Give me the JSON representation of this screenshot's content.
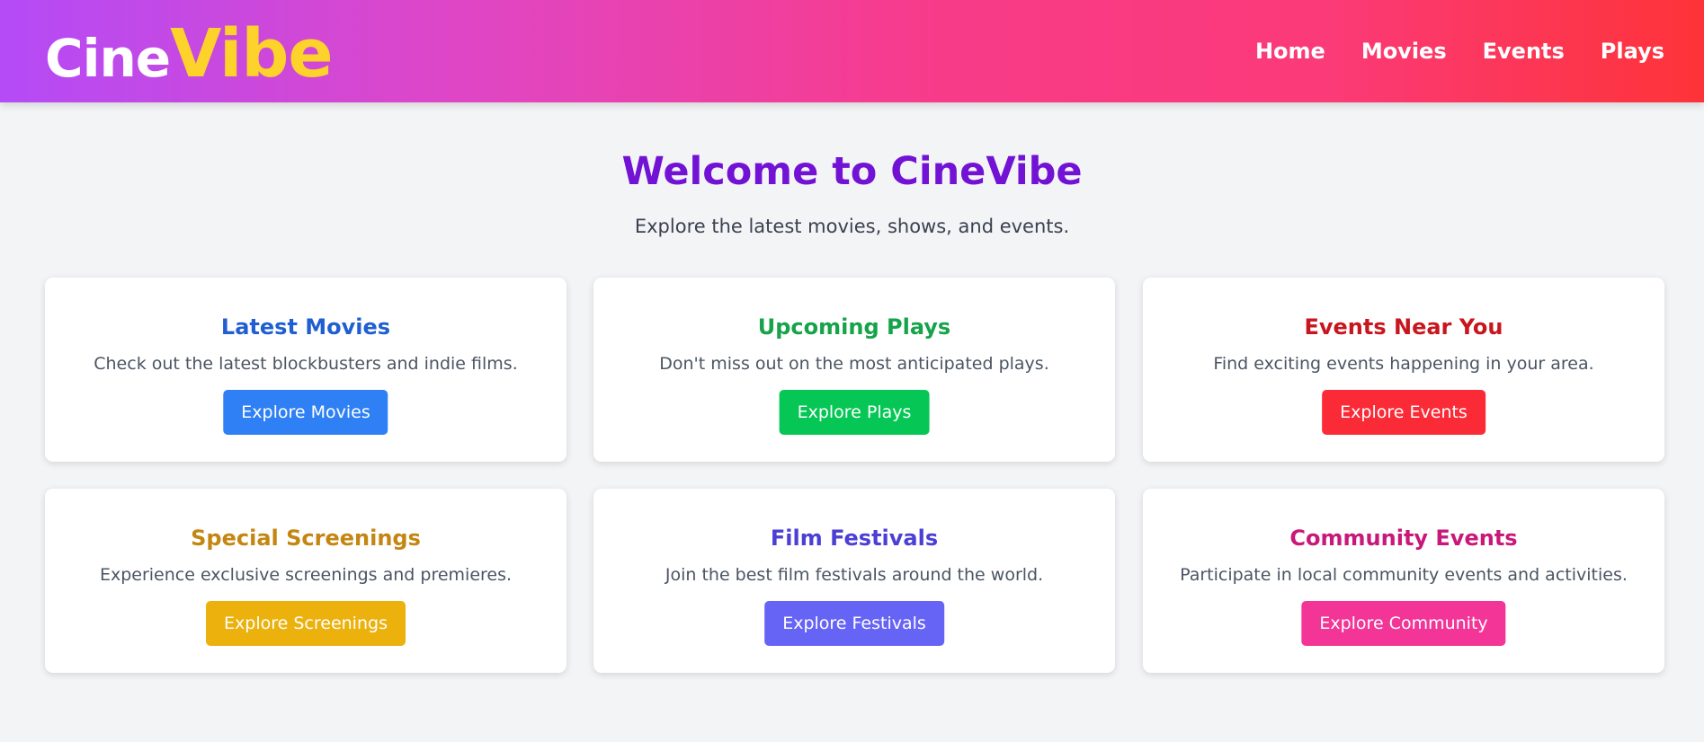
{
  "header": {
    "logo_part1": "Cine",
    "logo_part2": "Vibe",
    "nav": [
      "Home",
      "Movies",
      "Events",
      "Plays"
    ]
  },
  "hero": {
    "title": "Welcome to CineVibe",
    "subtitle": "Explore the latest movies, shows, and events."
  },
  "cards": [
    {
      "title": "Latest Movies",
      "description": "Check out the latest blockbusters and indie films.",
      "button": "Explore Movies",
      "title_color": "#1f5fd1",
      "button_color": "#2f80f5"
    },
    {
      "title": "Upcoming Plays",
      "description": "Don't miss out on the most anticipated plays.",
      "button": "Explore Plays",
      "title_color": "#16a34a",
      "button_color": "#06c755"
    },
    {
      "title": "Events Near You",
      "description": "Find exciting events happening in your area.",
      "button": "Explore Events",
      "title_color": "#c8161e",
      "button_color": "#fa2a37"
    },
    {
      "title": "Special Screenings",
      "description": "Experience exclusive screenings and premieres.",
      "button": "Explore Screenings",
      "title_color": "#c48611",
      "button_color": "#ecb10c"
    },
    {
      "title": "Film Festivals",
      "description": "Join the best film festivals around the world.",
      "button": "Explore Festivals",
      "title_color": "#4c3fd6",
      "button_color": "#6664f5"
    },
    {
      "title": "Community Events",
      "description": "Participate in local community events and activities.",
      "button": "Explore Community",
      "title_color": "#c8187a",
      "button_color": "#f23596"
    }
  ]
}
